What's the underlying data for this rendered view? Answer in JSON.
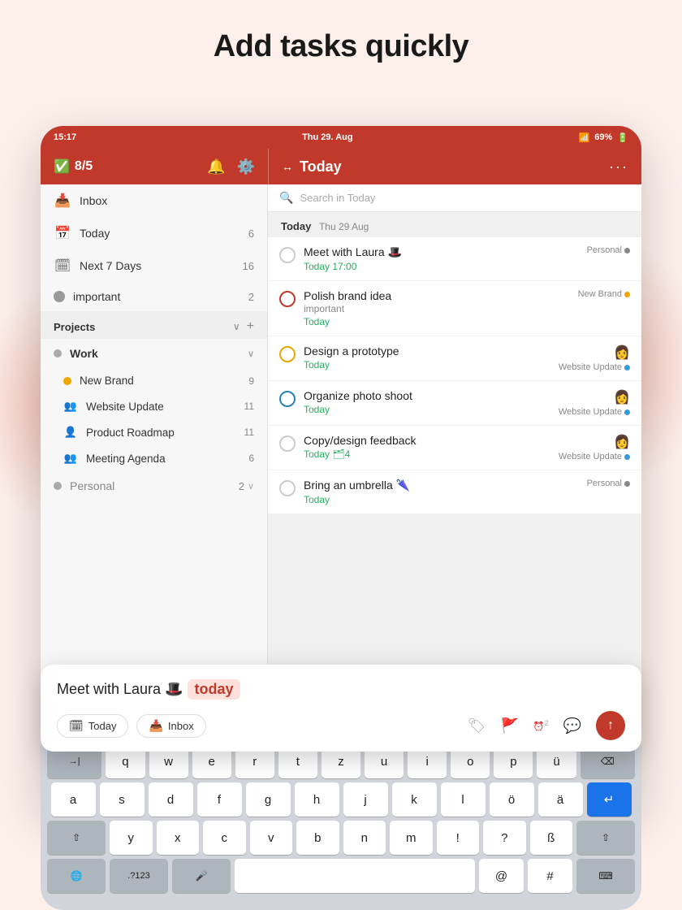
{
  "page": {
    "title": "Add tasks quickly"
  },
  "status_bar": {
    "time": "15:17",
    "date": "Thu 29. Aug",
    "wifi": "wifi",
    "battery": "69%"
  },
  "sidebar_header": {
    "score": "8/5",
    "bell_icon": "bell",
    "gear_icon": "gear"
  },
  "main_header": {
    "collapse_icon": "collapse",
    "title": "Today",
    "more_icon": "more"
  },
  "sidebar": {
    "items": [
      {
        "id": "inbox",
        "icon": "📥",
        "label": "Inbox",
        "count": ""
      },
      {
        "id": "today",
        "icon": "📅",
        "label": "Today",
        "count": "6"
      },
      {
        "id": "next7days",
        "icon": "🗓",
        "label": "Next 7 Days",
        "count": "16"
      },
      {
        "id": "important",
        "icon": "⬜",
        "label": "important",
        "count": "2"
      }
    ],
    "projects_label": "Projects",
    "work_label": "Work",
    "projects": [
      {
        "id": "new-brand",
        "color": "#f0a500",
        "label": "New Brand",
        "count": "9"
      },
      {
        "id": "website-update",
        "color": "#3498db",
        "label": "Website Update",
        "count": "11",
        "icon": "👥"
      },
      {
        "id": "product-roadmap",
        "color": "#e74c3c",
        "label": "Product Roadmap",
        "count": "11",
        "icon": "👤"
      },
      {
        "id": "meeting-agenda",
        "color": "#e74c3c",
        "label": "Meeting Agenda",
        "count": "6",
        "icon": "👥"
      }
    ],
    "personal_label": "Personal",
    "personal_count": "2"
  },
  "search": {
    "placeholder": "Search in Today"
  },
  "today_section": {
    "label": "Today",
    "date": "Thu 29 Aug"
  },
  "tasks": [
    {
      "id": "task1",
      "name": "Meet with Laura 🎩",
      "date": "Today 17:00",
      "project": "Personal",
      "project_color": "#888",
      "circle_type": "default",
      "sub": ""
    },
    {
      "id": "task2",
      "name": "Polish brand idea",
      "date": "Today",
      "sub": "important",
      "project": "New Brand",
      "project_color": "#f0a500",
      "circle_type": "red-outline"
    },
    {
      "id": "task3",
      "name": "Design a prototype",
      "date": "Today",
      "sub": "",
      "project": "Website Update",
      "project_color": "#3498db",
      "circle_type": "yellow",
      "avatar": "👩"
    },
    {
      "id": "task4",
      "name": "Organize photo shoot",
      "date": "Today",
      "sub": "",
      "project": "Website Update",
      "project_color": "#3498db",
      "circle_type": "blue",
      "avatar": "👩"
    },
    {
      "id": "task5",
      "name": "Copy/design feedback",
      "date": "Today 🗂4",
      "sub": "",
      "project": "Website Update",
      "project_color": "#3498db",
      "circle_type": "default",
      "avatar": "👩"
    },
    {
      "id": "task6",
      "name": "Bring an umbrella 🌂",
      "date": "Today",
      "sub": "",
      "project": "Personal",
      "project_color": "#888",
      "circle_type": "default"
    }
  ],
  "quick_add": {
    "text_part1": "Meet with Laura 🎩",
    "text_tag": "today",
    "today_btn": "Today",
    "inbox_btn": "Inbox",
    "tag_icon": "🏷",
    "flag_icon": "🚩",
    "alarm_icon": "⏰",
    "alarm_count": "2",
    "comment_icon": "💬",
    "send_icon": "↑"
  },
  "keyboard": {
    "rows": [
      [
        "→|",
        "q",
        "w",
        "e",
        "r",
        "t",
        "z",
        "u",
        "i",
        "o",
        "p",
        "ü",
        "⌫"
      ],
      [
        "a",
        "s",
        "d",
        "f",
        "g",
        "h",
        "j",
        "k",
        "l",
        "ö",
        "ä",
        "↵"
      ],
      [
        "⇧",
        "y",
        "x",
        "c",
        "v",
        "b",
        "n",
        "m",
        "!",
        "?",
        "ß",
        "⇧"
      ],
      [
        "🌐",
        ".?123",
        "🎤",
        "",
        "@",
        "#",
        "⌨"
      ]
    ]
  }
}
